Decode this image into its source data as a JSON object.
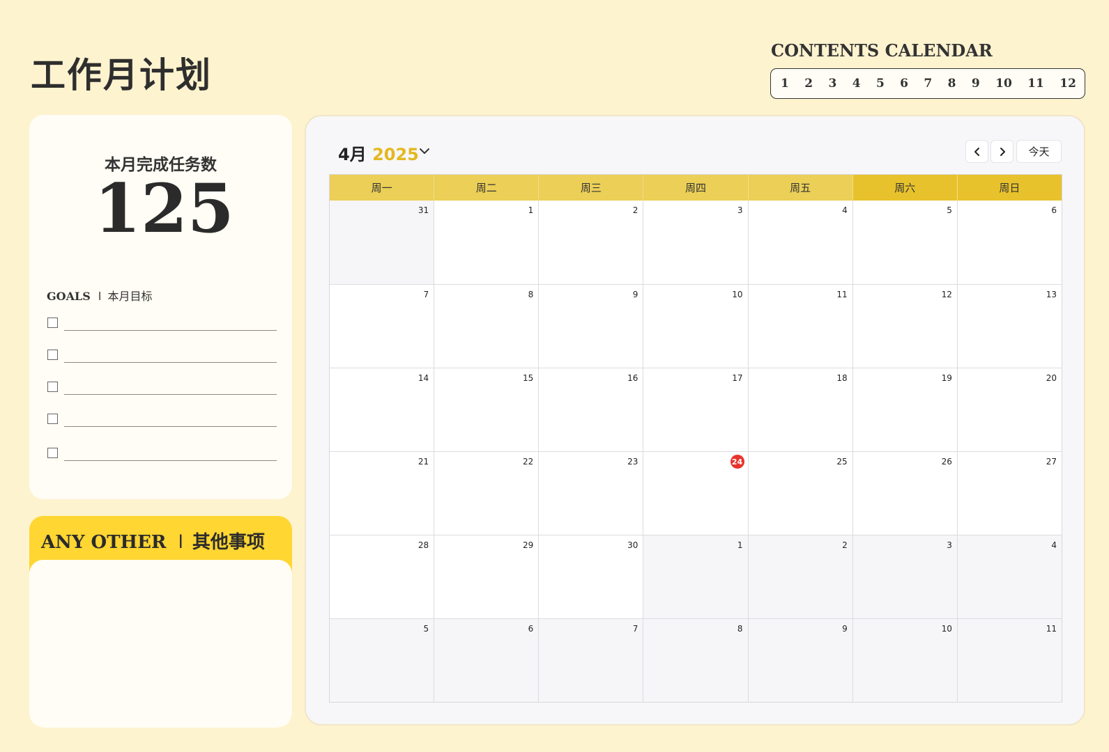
{
  "page": {
    "title": "工作月计划"
  },
  "contents_calendar": {
    "title": "CONTENTS CALENDAR",
    "months": [
      "1",
      "2",
      "3",
      "4",
      "5",
      "6",
      "7",
      "8",
      "9",
      "10",
      "11",
      "12"
    ]
  },
  "stats": {
    "label": "本月完成任务数",
    "value": "125"
  },
  "goals": {
    "title_en": "GOALS",
    "title_sep": "l",
    "title_cn": "本月目标",
    "count": 5
  },
  "other": {
    "title_en": "ANY OTHER",
    "title_sep": "l",
    "title_cn": "其他事项"
  },
  "calendar": {
    "month_label": "4月",
    "year_label": "2025",
    "today_button": "今天",
    "weekdays": [
      "周一",
      "周二",
      "周三",
      "周四",
      "周五",
      "周六",
      "周日"
    ],
    "weeks": [
      [
        {
          "d": "31",
          "o": true
        },
        {
          "d": "1"
        },
        {
          "d": "2"
        },
        {
          "d": "3"
        },
        {
          "d": "4"
        },
        {
          "d": "5"
        },
        {
          "d": "6"
        }
      ],
      [
        {
          "d": "7"
        },
        {
          "d": "8"
        },
        {
          "d": "9"
        },
        {
          "d": "10"
        },
        {
          "d": "11"
        },
        {
          "d": "12"
        },
        {
          "d": "13"
        }
      ],
      [
        {
          "d": "14"
        },
        {
          "d": "15"
        },
        {
          "d": "16"
        },
        {
          "d": "17"
        },
        {
          "d": "18"
        },
        {
          "d": "19"
        },
        {
          "d": "20"
        }
      ],
      [
        {
          "d": "21"
        },
        {
          "d": "22"
        },
        {
          "d": "23"
        },
        {
          "d": "24",
          "t": true
        },
        {
          "d": "25"
        },
        {
          "d": "26"
        },
        {
          "d": "27"
        }
      ],
      [
        {
          "d": "28"
        },
        {
          "d": "29"
        },
        {
          "d": "30"
        },
        {
          "d": "1",
          "o": true
        },
        {
          "d": "2",
          "o": true
        },
        {
          "d": "3",
          "o": true
        },
        {
          "d": "4",
          "o": true
        }
      ],
      [
        {
          "d": "5",
          "o": true
        },
        {
          "d": "6",
          "o": true
        },
        {
          "d": "7",
          "o": true
        },
        {
          "d": "8",
          "o": true
        },
        {
          "d": "9",
          "o": true
        },
        {
          "d": "10",
          "o": true
        },
        {
          "d": "11",
          "o": true
        }
      ]
    ]
  },
  "colors": {
    "accent": "#ffd632",
    "header": "#ebcf57",
    "today": "#e8332d",
    "background": "#fef3cf"
  }
}
